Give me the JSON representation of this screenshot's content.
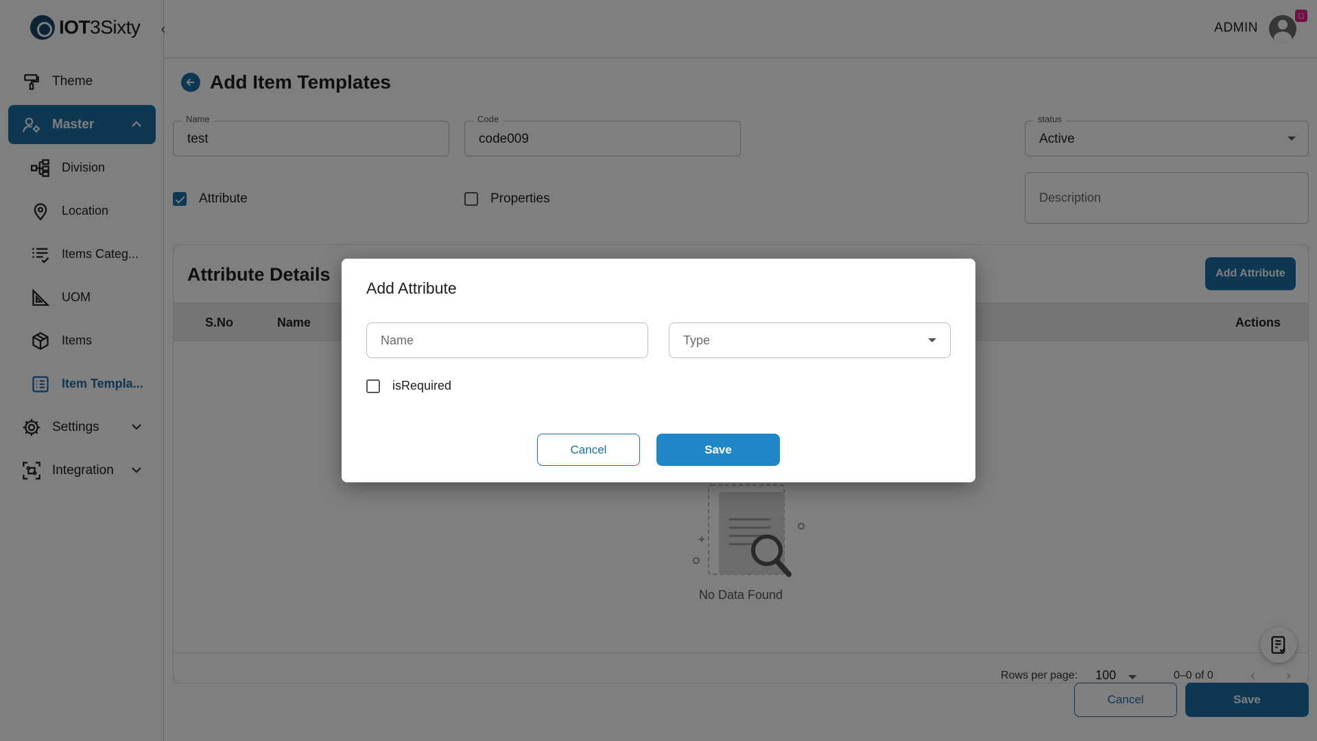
{
  "app": {
    "logo_bold": "IOT",
    "logo_rest": "3Sixty"
  },
  "header": {
    "user_label": "ADMIN"
  },
  "sidebar": {
    "items": [
      {
        "label": "Theme",
        "icon": "paint-roller-icon"
      },
      {
        "label": "Master",
        "icon": "users-gear-icon",
        "active": true,
        "expanded": true
      },
      {
        "label": "Settings",
        "icon": "gear-icon"
      },
      {
        "label": "Integration",
        "icon": "scan-icon"
      }
    ],
    "sub_items": [
      {
        "label": "Division",
        "icon": "hierarchy-icon"
      },
      {
        "label": "Location",
        "icon": "location-pin-icon"
      },
      {
        "label": "Items Categ...",
        "icon": "list-check-icon"
      },
      {
        "label": "UOM",
        "icon": "ruler-triangle-icon"
      },
      {
        "label": "Items",
        "icon": "box-icon"
      },
      {
        "label": "Item Templa...",
        "icon": "template-list-icon",
        "current": true
      }
    ]
  },
  "page": {
    "title": "Add Item Templates",
    "form": {
      "name_label": "Name",
      "name_value": "test",
      "code_label": "Code",
      "code_value": "code009",
      "status_label": "status",
      "status_value": "Active",
      "description_placeholder": "Description",
      "attribute_label": "Attribute",
      "attribute_checked": true,
      "properties_label": "Properties",
      "properties_checked": false
    },
    "details": {
      "title": "Attribute Details",
      "add_button": "Add Attribute",
      "columns": [
        "S.No",
        "Name",
        "Actions"
      ],
      "empty_text": "No Data Found",
      "rows_per_page_label": "Rows per page:",
      "rows_per_page_value": "100",
      "pagination_text": "0–0 of 0"
    },
    "actions": {
      "cancel": "Cancel",
      "save": "Save"
    }
  },
  "modal": {
    "title": "Add Attribute",
    "name_placeholder": "Name",
    "type_placeholder": "Type",
    "required_label": "isRequired",
    "required_checked": false,
    "cancel": "Cancel",
    "save": "Save"
  },
  "colors": {
    "primary": "#1c6fa6",
    "overlay": "rgba(0,0,0,0.5)"
  }
}
